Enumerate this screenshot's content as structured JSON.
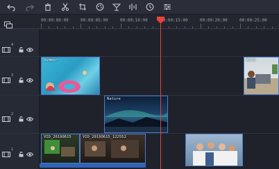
{
  "toolbar": {
    "icons": [
      "undo-icon",
      "redo-icon",
      "delete-icon",
      "cut-icon",
      "crop-icon",
      "color-icon",
      "speed-icon",
      "audio-icon",
      "clock-icon",
      "adjust-icon"
    ]
  },
  "ruler": {
    "labels": [
      "00:00:00:00",
      "00:00:05:00",
      "00:00:10:00",
      "00:00:15:00",
      "00:00:20:00",
      "00:00:25:00"
    ]
  },
  "tracks": [
    {
      "number": "4"
    },
    {
      "number": "3"
    },
    {
      "number": "2"
    },
    {
      "number": "1"
    }
  ],
  "clips": {
    "summer": {
      "label": "Summer"
    },
    "work": {
      "label": "Work"
    },
    "nature": {
      "label": "Nature"
    },
    "vid1": {
      "label": "VID_20190615"
    },
    "vid2": {
      "label": "VID_20190615_122552"
    }
  },
  "colors": {
    "accent": "#e6453a",
    "selection": "#2f63b8"
  }
}
